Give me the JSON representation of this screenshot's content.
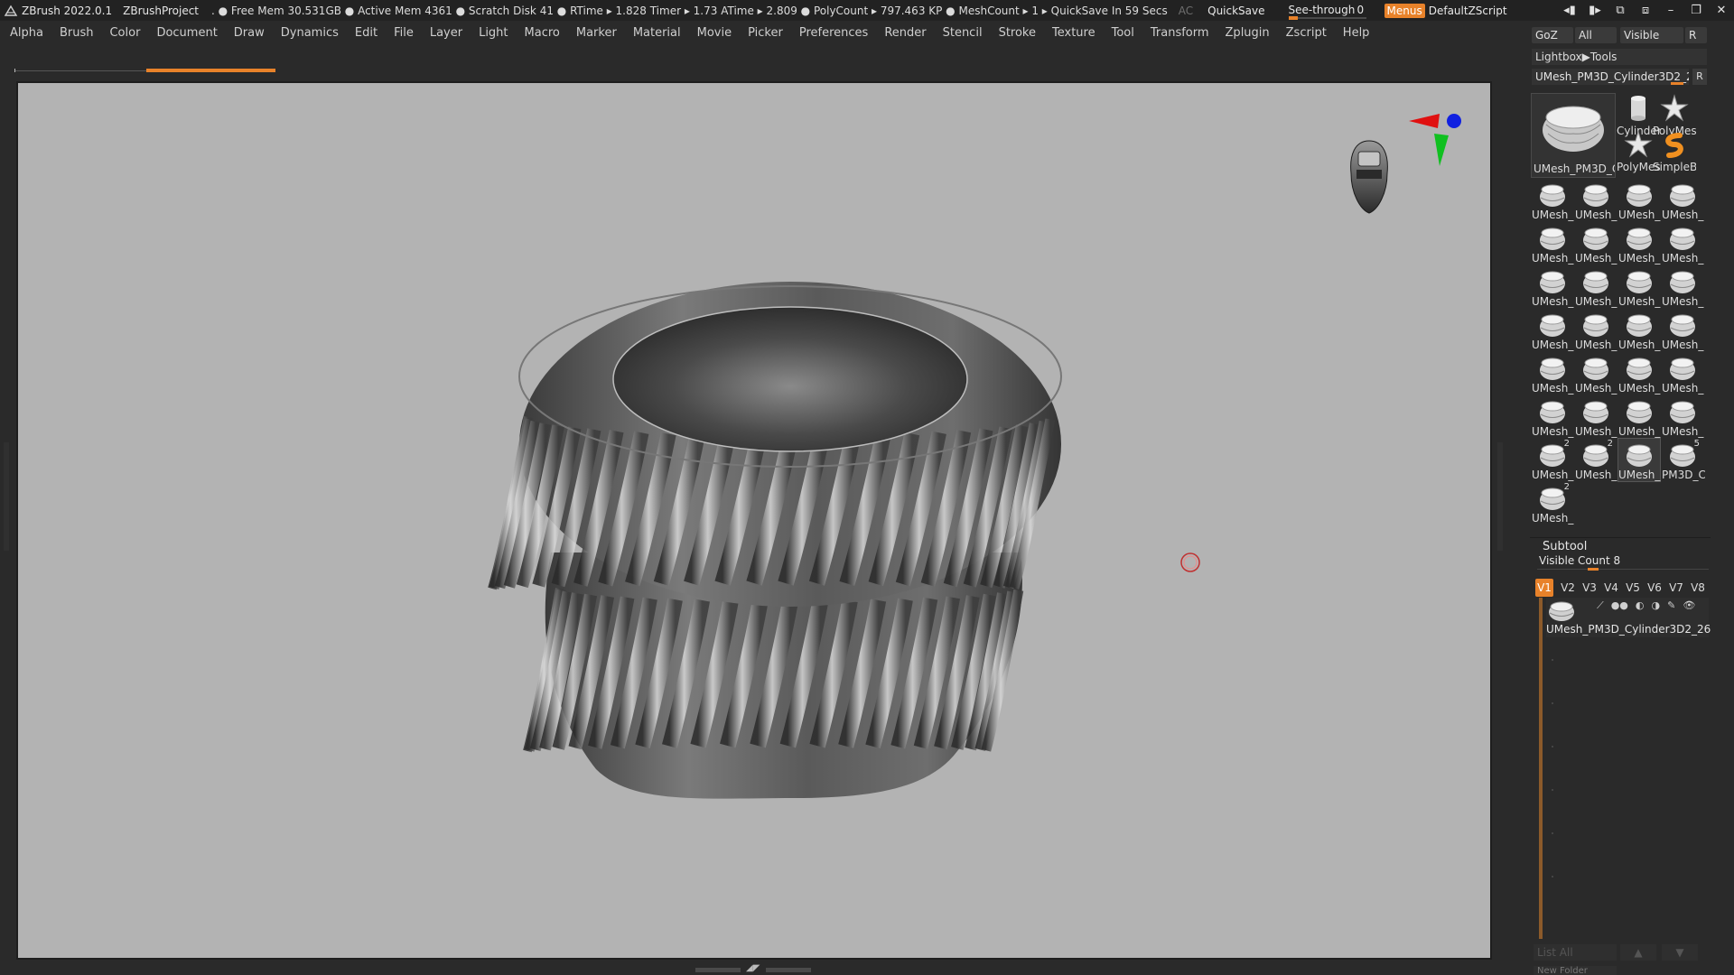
{
  "titlebar": {
    "app": "ZBrush 2022.0.1",
    "project": "ZBrushProject",
    "status": ". ● Free Mem 30.531GB ● Active Mem 4361 ● Scratch Disk 41 ● RTime ▸ 1.828 Timer ▸ 1.73 ATime ▸ 2.809 ● PolyCount ▸ 797.463 KP ● MeshCount ▸ 1 ▸ QuickSave In 59 Secs",
    "ac": "AC",
    "quicksave": "QuickSave",
    "seethrough_label": "See-through",
    "seethrough_value": "0",
    "menus": "Menus",
    "default_zscript": "DefaultZScript"
  },
  "menubar": [
    "Alpha",
    "Brush",
    "Color",
    "Document",
    "Draw",
    "Dynamics",
    "Edit",
    "File",
    "Layer",
    "Light",
    "Macro",
    "Marker",
    "Material",
    "Movie",
    "Picker",
    "Preferences",
    "Render",
    "Stencil",
    "Stroke",
    "Texture",
    "Tool",
    "Transform",
    "Zplugin",
    "Zscript",
    "Help"
  ],
  "tool_panel": {
    "goz": "GoZ",
    "all": "All",
    "visible": "Visible",
    "r": "R",
    "lightbox": "Lightbox▶Tools",
    "current_tool": "UMesh_PM3D_Cylinder3D2_2",
    "big_thumb_label": "UMesh_PM3D_C",
    "top_thumbs": [
      {
        "label": "Cylinder",
        "icon": "cylinder-icon"
      },
      {
        "label": "PolyMes",
        "icon": "star-icon"
      },
      {
        "label": "PolyMes",
        "icon": "star-icon"
      },
      {
        "label": "SimpleB",
        "icon": "simple-brush-icon"
      }
    ],
    "grid_thumbs": [
      "UMesh_",
      "UMesh_",
      "UMesh_",
      "UMesh_",
      "UMesh_",
      "UMesh_",
      "UMesh_",
      "UMesh_",
      "UMesh_",
      "UMesh_",
      "UMesh_",
      "UMesh_",
      "UMesh_",
      "UMesh_",
      "UMesh_",
      "UMesh_",
      "UMesh_",
      "UMesh_",
      "UMesh_",
      "UMesh_",
      "UMesh_",
      "UMesh_",
      "UMesh_",
      "UMesh_",
      "UMesh_",
      "UMesh_",
      "UMesh_",
      "PM3D_C",
      "UMesh_"
    ],
    "grid_badges": {
      "24": "2",
      "25": "2",
      "27": "5",
      "28": "2"
    },
    "selected_index": 26
  },
  "subtool": {
    "title": "Subtool",
    "visible_count": "Visible Count 8",
    "versions": [
      "V1",
      "V2",
      "V3",
      "V4",
      "V5",
      "V6",
      "V7",
      "V8"
    ],
    "active_version": "V1",
    "item_name": "UMesh_PM3D_Cylinder3D2_26",
    "list_all": "List All",
    "new_folder": "New Folder"
  },
  "colors": {
    "accent": "#e8822a",
    "canvas": "#b3b3b3",
    "ui_bg": "#2a2a2a",
    "gizmo_x": "#e01010",
    "gizmo_y": "#10c020",
    "gizmo_z": "#1020e0"
  }
}
